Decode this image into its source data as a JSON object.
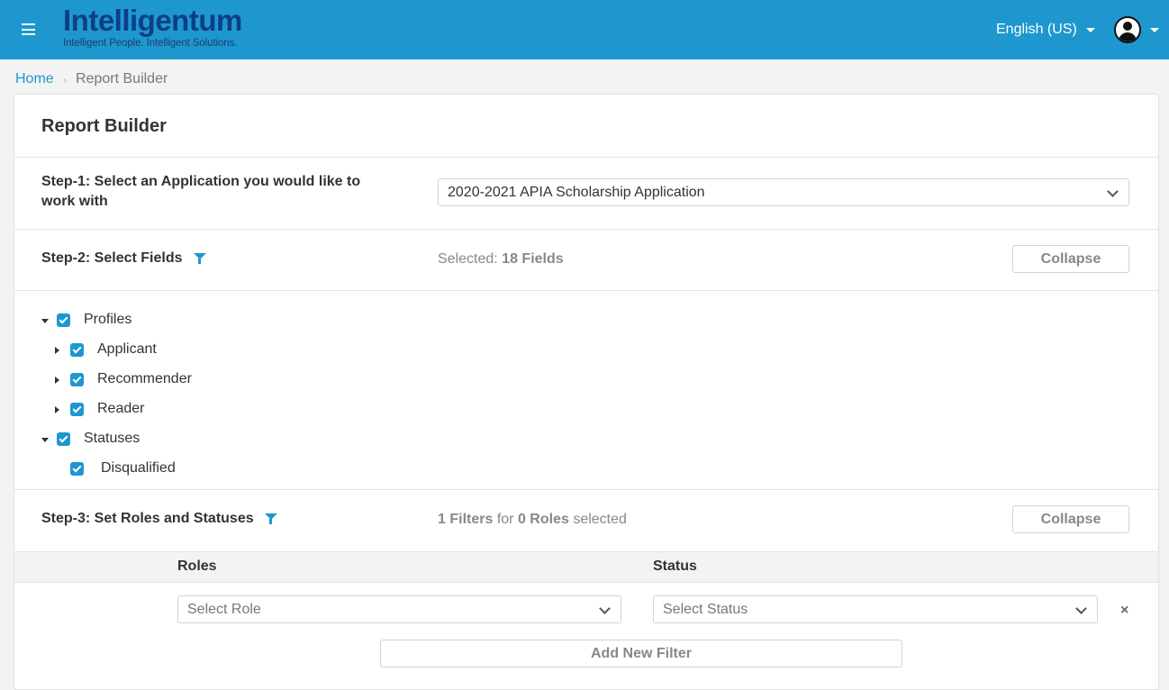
{
  "header": {
    "brand_name": "Intelligentum",
    "brand_tagline": "Intelligent People. Intelligent Solutions.",
    "menu_icon": "hamburger-icon",
    "language": "English (US)",
    "user_icon": "user-avatar-icon",
    "colors": {
      "bar": "#1e97cf",
      "logo": "#0b3f86"
    }
  },
  "breadcrumb": {
    "home": "Home",
    "current": "Report Builder"
  },
  "page": {
    "title": "Report Builder"
  },
  "step1": {
    "label": "Step-1: Select an Application you would like to work with",
    "selected_application": "2020-2021 APIA Scholarship Application"
  },
  "step2": {
    "label": "Step-2: Select Fields",
    "selected_prefix": "Selected:",
    "selected_count": "18 Fields",
    "collapse_label": "Collapse",
    "tree": [
      {
        "label": "Profiles",
        "checked": true,
        "expanded": true,
        "children": [
          {
            "label": "Applicant",
            "checked": true,
            "expanded": false
          },
          {
            "label": "Recommender",
            "checked": true,
            "expanded": false
          },
          {
            "label": "Reader",
            "checked": true,
            "expanded": false
          }
        ]
      },
      {
        "label": "Statuses",
        "checked": true,
        "expanded": true,
        "children": [
          {
            "label": "Disqualified",
            "checked": true
          }
        ]
      }
    ]
  },
  "step3": {
    "label": "Step-3: Set Roles and Statuses",
    "filters_count": "1 Filters",
    "for_text": "for",
    "roles_count": "0 Roles",
    "selected_text": "selected",
    "collapse_label": "Collapse",
    "col_roles": "Roles",
    "col_status": "Status",
    "role_placeholder": "Select Role",
    "status_placeholder": "Select Status",
    "remove_symbol": "×",
    "add_filter_label": "Add New Filter"
  }
}
